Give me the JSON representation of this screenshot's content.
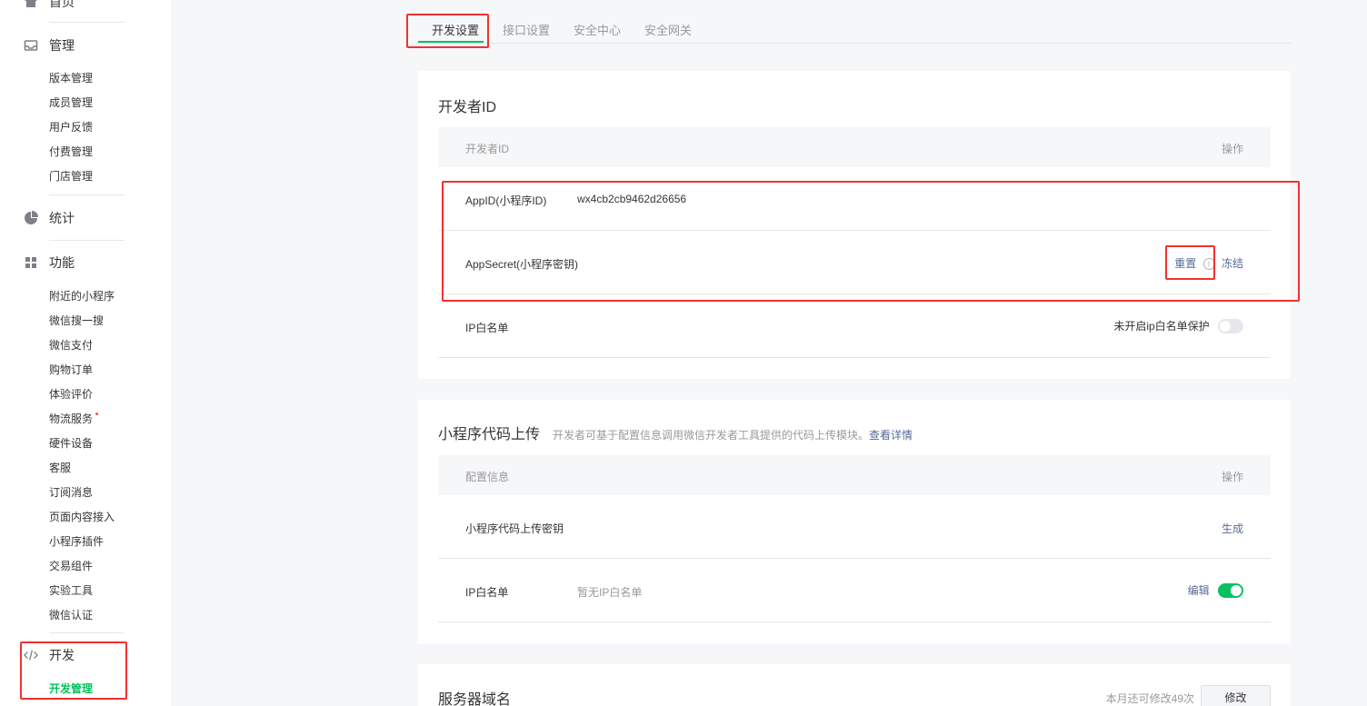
{
  "sidebar": {
    "home": "首页",
    "manage": {
      "label": "管理",
      "items": [
        "版本管理",
        "成员管理",
        "用户反馈",
        "付费管理",
        "门店管理"
      ]
    },
    "stats": {
      "label": "统计"
    },
    "features": {
      "label": "功能",
      "items": [
        "附近的小程序",
        "微信搜一搜",
        "微信支付",
        "购物订单",
        "体验评价",
        "物流服务",
        "硬件设备",
        "客服",
        "订阅消息",
        "页面内容接入",
        "小程序插件",
        "交易组件",
        "实验工具",
        "微信认证"
      ]
    },
    "dev": {
      "label": "开发",
      "items": [
        "开发管理"
      ]
    }
  },
  "tabs": [
    "开发设置",
    "接口设置",
    "安全中心",
    "安全网关"
  ],
  "dev_id_card": {
    "title": "开发者ID",
    "col_left": "开发者ID",
    "col_right": "操作",
    "appid_label": "AppID(小程序ID)",
    "appid_value": "wx4cb2cb9462d26656",
    "secret_label": "AppSecret(小程序密钥)",
    "secret_reset": "重置",
    "secret_info": "i",
    "secret_freeze": "冻结",
    "ip_label": "IP白名单",
    "ip_status": "未开启ip白名单保护"
  },
  "upload_card": {
    "title": "小程序代码上传",
    "desc": "开发者可基于配置信息调用微信开发者工具提供的代码上传模块。",
    "desc_link": "查看详情",
    "col_left": "配置信息",
    "col_right": "操作",
    "key_label": "小程序代码上传密钥",
    "key_action": "生成",
    "ip_label": "IP白名单",
    "ip_value": "暂无IP白名单",
    "ip_action": "编辑"
  },
  "server_card": {
    "title": "服务器域名",
    "remaining": "本月还可修改49次",
    "modify": "修改"
  },
  "colors": {
    "accent": "#07c160",
    "link": "#576b95",
    "highlight": "#f23030"
  }
}
